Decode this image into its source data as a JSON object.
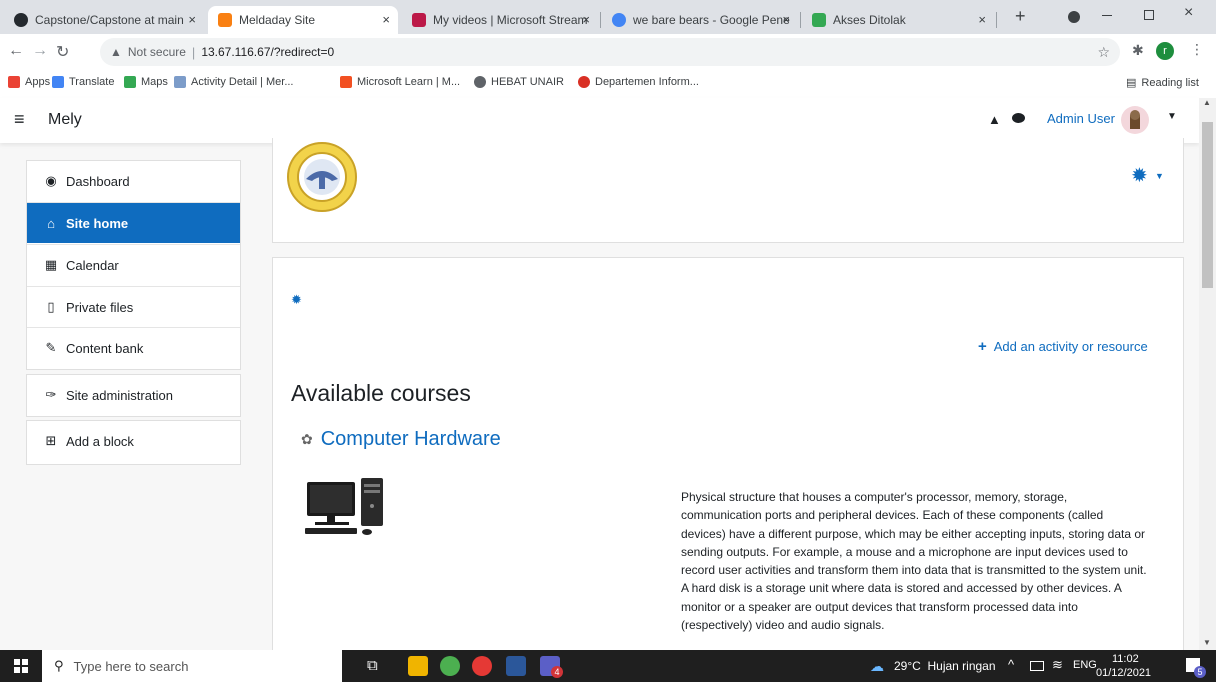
{
  "browser": {
    "tabs": [
      {
        "title": "Capstone/Capstone at main",
        "color": "#24292e"
      },
      {
        "title": "Meldaday Site",
        "color": "#f98012"
      },
      {
        "title": "My videos | Microsoft Stream",
        "color": "#bc1948"
      },
      {
        "title": "we bare bears - Google Pene",
        "color": "#4285f4"
      },
      {
        "title": "Akses Ditolak",
        "color": "#34a853"
      }
    ],
    "close_glyph": "×",
    "new_tab_glyph": "+",
    "security_label": "Not secure",
    "url": "13.67.116.67/?redirect=0",
    "profile_initial": "r",
    "bookmarks": [
      {
        "label": "Apps",
        "color": "#ea4335"
      },
      {
        "label": "Translate",
        "color": "#4285f4"
      },
      {
        "label": "Maps",
        "color": "#34a853"
      },
      {
        "label": "Activity Detail | Mer...",
        "color": "#7c9cc9"
      },
      {
        "label": "Microsoft Learn | M...",
        "color": "#f25022"
      },
      {
        "label": "HEBAT UNAIR",
        "color": "#5f6368"
      },
      {
        "label": "Departemen Inform...",
        "color": "#d93025"
      }
    ],
    "reading_list": "Reading list"
  },
  "site": {
    "name": "Mely",
    "user_name": "Admin User"
  },
  "sidebar": {
    "items": [
      {
        "label": "Dashboard",
        "icon": "dashboard-icon",
        "glyph": "◉"
      },
      {
        "label": "Site home",
        "icon": "home-icon",
        "glyph": "⌂"
      },
      {
        "label": "Calendar",
        "icon": "calendar-icon",
        "glyph": "▦"
      },
      {
        "label": "Private files",
        "icon": "file-icon",
        "glyph": "▯"
      },
      {
        "label": "Content bank",
        "icon": "brush-icon",
        "glyph": "✎"
      }
    ],
    "admin_label": "Site administration",
    "add_block_label": "Add a block"
  },
  "main": {
    "add_activity_label": "Add an activity or resource",
    "available_courses_title": "Available courses",
    "course": {
      "name": "Computer Hardware",
      "summary": "Physical structure that houses a computer's processor, memory, storage, communication ports and peripheral devices. Each of these components (called devices) have a different purpose, which may be either accepting inputs, storing data or sending outputs. For example, a mouse and a microphone are input devices used to record user activities and transform them into data that is transmitted to the system unit. A hard disk is a storage unit where data is stored and accessed by other devices. A monitor or a speaker are output devices that transform processed data into (respectively) video and audio signals."
    }
  },
  "taskbar": {
    "search_placeholder": "Type here to search",
    "weather": "29°C  Hujan ringan",
    "lang": "ENG",
    "time": "11:02",
    "date": "01/12/2021",
    "notif_count": "5",
    "teams_badge": "4"
  },
  "colors": {
    "accent": "#0f6cbf",
    "seal": "#c9a227"
  }
}
